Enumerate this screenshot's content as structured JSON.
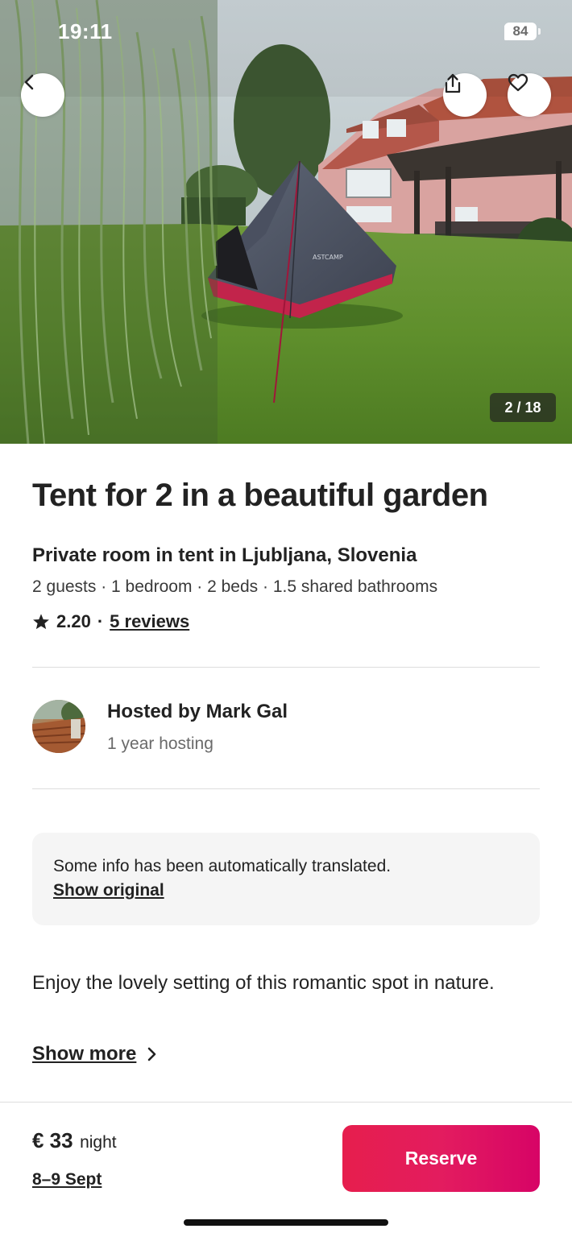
{
  "status_bar": {
    "time": "19:11",
    "battery": "84"
  },
  "photo": {
    "counter": "2 / 18",
    "tent_brand": "ASTCAMP"
  },
  "listing": {
    "title": "Tent for 2 in a beautiful garden",
    "subtitle": "Private room in tent in Ljubljana, Slovenia",
    "details": "2 guests · 1 bedroom · 2 beds · 1.5 shared bathrooms",
    "rating": "2.20",
    "separator": "·",
    "reviews_link": "5 reviews"
  },
  "host": {
    "name": "Hosted by Mark Gal",
    "meta": "1 year hosting"
  },
  "translation": {
    "notice": "Some info has been automatically translated.",
    "show_original": "Show original"
  },
  "description": {
    "text": "Enjoy the lovely setting of this romantic spot in nature.",
    "show_more": "Show more"
  },
  "footer": {
    "price_amount": "€ 33",
    "price_unit": "night",
    "dates": "8–9 Sept",
    "reserve_label": "Reserve"
  },
  "icons": {
    "back": "chevron-left-icon",
    "share": "share-icon",
    "favorite": "heart-icon",
    "star": "star-icon",
    "show_more": "chevron-right-icon"
  },
  "colors": {
    "brand": "#e31c5f",
    "text": "#222222",
    "muted": "#6a6a6a",
    "divider": "#dddddd",
    "notice_bg": "#f5f5f5"
  }
}
